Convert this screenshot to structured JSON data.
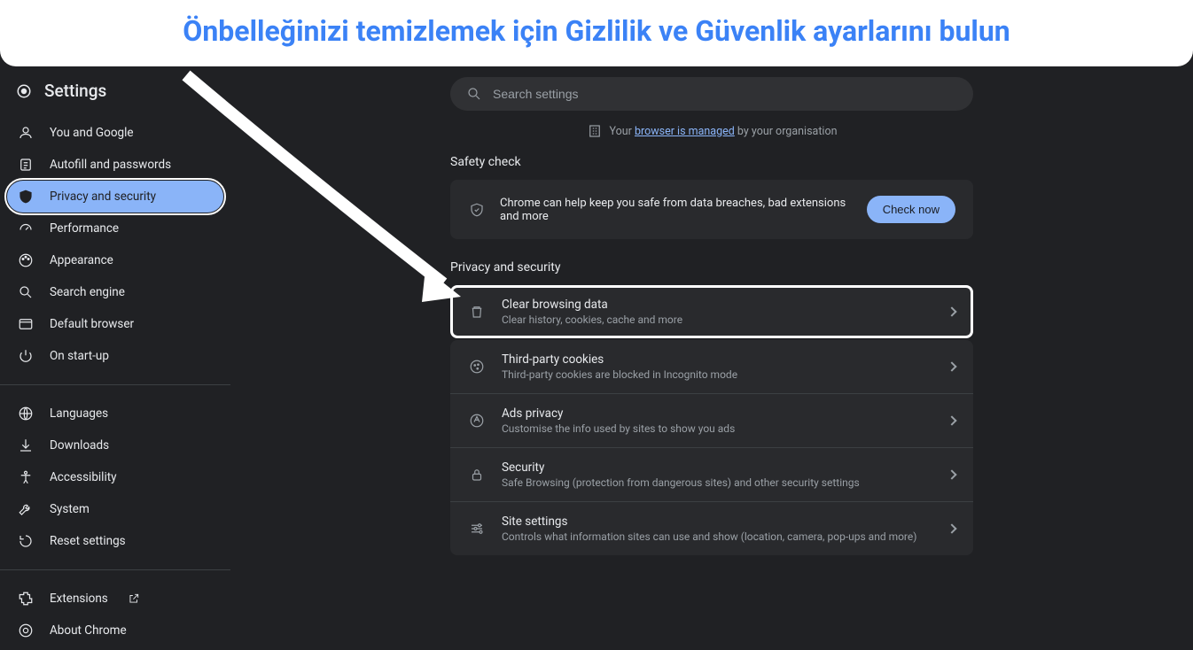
{
  "banner": {
    "text": "Önbelleğinizi temizlemek için Gizlilik ve Güvenlik ayarlarını bulun"
  },
  "header": {
    "title": "Settings"
  },
  "sidebar": {
    "groups": [
      {
        "items": [
          {
            "id": "you-google",
            "label": "You and Google",
            "icon": "person"
          },
          {
            "id": "autofill",
            "label": "Autofill and passwords",
            "icon": "assignment"
          },
          {
            "id": "privacy",
            "label": "Privacy and security",
            "icon": "shield",
            "selected": true
          },
          {
            "id": "performance",
            "label": "Performance",
            "icon": "speed"
          },
          {
            "id": "appearance",
            "label": "Appearance",
            "icon": "palette"
          },
          {
            "id": "search-engine",
            "label": "Search engine",
            "icon": "search"
          },
          {
            "id": "default-browser",
            "label": "Default browser",
            "icon": "browser"
          },
          {
            "id": "startup",
            "label": "On start-up",
            "icon": "power"
          }
        ]
      },
      {
        "items": [
          {
            "id": "languages",
            "label": "Languages",
            "icon": "globe"
          },
          {
            "id": "downloads",
            "label": "Downloads",
            "icon": "download"
          },
          {
            "id": "accessibility",
            "label": "Accessibility",
            "icon": "accessibility"
          },
          {
            "id": "system",
            "label": "System",
            "icon": "wrench"
          },
          {
            "id": "reset",
            "label": "Reset settings",
            "icon": "restore"
          }
        ]
      },
      {
        "items": [
          {
            "id": "extensions",
            "label": "Extensions",
            "icon": "extension",
            "external": true
          },
          {
            "id": "about",
            "label": "About Chrome",
            "icon": "chrome"
          }
        ]
      }
    ]
  },
  "search": {
    "placeholder": "Search settings"
  },
  "managed": {
    "prefix": "Your ",
    "link": "browser is managed",
    "suffix": " by your organisation"
  },
  "safety": {
    "title": "Safety check",
    "text": "Chrome can help keep you safe from data breaches, bad extensions and more",
    "button": "Check now"
  },
  "privacy_section": {
    "title": "Privacy and security",
    "rows": [
      {
        "id": "clear-data",
        "title": "Clear browsing data",
        "sub": "Clear history, cookies, cache and more",
        "icon": "trash",
        "highlight": true
      },
      {
        "id": "third-party",
        "title": "Third-party cookies",
        "sub": "Third-party cookies are blocked in Incognito mode",
        "icon": "cookie"
      },
      {
        "id": "ads-privacy",
        "title": "Ads privacy",
        "sub": "Customise the info used by sites to show you ads",
        "icon": "ads"
      },
      {
        "id": "security",
        "title": "Security",
        "sub": "Safe Browsing (protection from dangerous sites) and other security settings",
        "icon": "lock"
      },
      {
        "id": "site-settings",
        "title": "Site settings",
        "sub": "Controls what information sites can use and show (location, camera, pop-ups and more)",
        "icon": "tune"
      }
    ]
  }
}
